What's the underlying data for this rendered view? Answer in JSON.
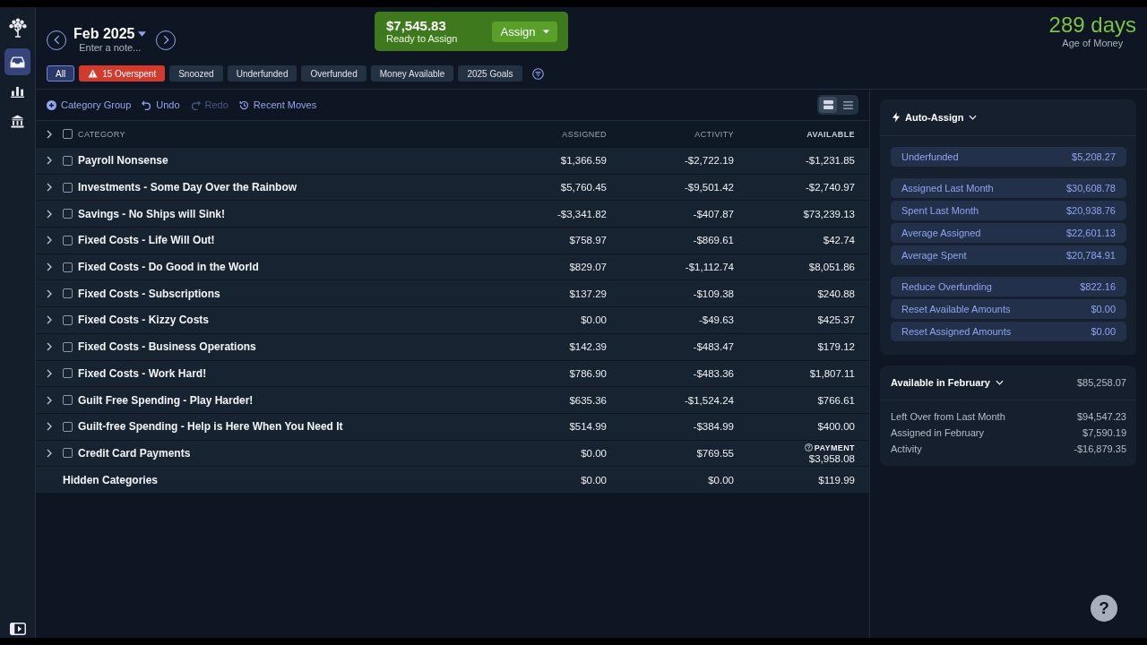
{
  "sidebar": {
    "items": [
      {
        "kind": "budget",
        "selected": true
      },
      {
        "kind": "reports",
        "selected": false
      },
      {
        "kind": "accounts",
        "selected": false
      }
    ]
  },
  "month": {
    "label": "Feb 2025",
    "note": {
      "placeholder": "Enter a note..."
    }
  },
  "ready_to_assign": {
    "amount": "$7,545.83",
    "label": "Ready to Assign",
    "button": "Assign"
  },
  "age_of_money": {
    "value": "289 days",
    "label": "Age of Money"
  },
  "filters": [
    {
      "label": "All",
      "kind": "plain",
      "selected": true
    },
    {
      "label": "15 Overspent",
      "kind": "alert",
      "selected": false
    },
    {
      "label": "Snoozed",
      "kind": "plain",
      "selected": false
    },
    {
      "label": "Underfunded",
      "kind": "plain",
      "selected": false
    },
    {
      "label": "Overfunded",
      "kind": "plain",
      "selected": false
    },
    {
      "label": "Money Available",
      "kind": "plain",
      "selected": false
    },
    {
      "label": "2025 Goals",
      "kind": "plain",
      "selected": false
    }
  ],
  "toolbar": [
    {
      "label": "Category Group",
      "kind": "add",
      "disabled": false
    },
    {
      "label": "Undo",
      "kind": "undo",
      "disabled": false
    },
    {
      "label": "Redo",
      "kind": "redo",
      "disabled": true
    },
    {
      "label": "Recent Moves",
      "kind": "history",
      "disabled": false
    }
  ],
  "view_toggle": [
    {
      "kind": "cards",
      "selected": true
    },
    {
      "kind": "list",
      "selected": false
    }
  ],
  "table": {
    "columns": [
      "CATEGORY",
      "ASSIGNED",
      "ACTIVITY",
      "AVAILABLE"
    ],
    "expand_all": {
      "expanded": false
    },
    "select_all": {
      "checked": false
    },
    "rows": [
      {
        "kind": "group",
        "name": "Payroll Nonsense",
        "assigned": "$1,366.59",
        "activity": "-$2,722.19",
        "available": "-$1,231.85",
        "expanded": false,
        "checked": false
      },
      {
        "kind": "group",
        "name": "Investments - Some Day Over the Rainbow",
        "assigned": "$5,760.45",
        "activity": "-$9,501.42",
        "available": "-$2,740.97",
        "expanded": false,
        "checked": false
      },
      {
        "kind": "group",
        "name": "Savings - No Ships will Sink!",
        "assigned": "-$3,341.82",
        "activity": "-$407.87",
        "available": "$73,239.13",
        "expanded": false,
        "checked": false
      },
      {
        "kind": "group",
        "name": "Fixed Costs - Life Will Out!",
        "assigned": "$758.97",
        "activity": "-$869.61",
        "available": "$42.74",
        "expanded": false,
        "checked": false
      },
      {
        "kind": "group",
        "name": "Fixed Costs - Do Good in the World",
        "assigned": "$829.07",
        "activity": "-$1,112.74",
        "available": "$8,051.86",
        "expanded": false,
        "checked": false
      },
      {
        "kind": "group",
        "name": "Fixed Costs - Subscriptions",
        "assigned": "$137.29",
        "activity": "-$109.38",
        "available": "$240.88",
        "expanded": false,
        "checked": false
      },
      {
        "kind": "group",
        "name": "Fixed Costs - Kizzy Costs",
        "assigned": "$0.00",
        "activity": "-$49.63",
        "available": "$425.37",
        "expanded": false,
        "checked": false
      },
      {
        "kind": "group",
        "name": "Fixed Costs - Business Operations",
        "assigned": "$142.39",
        "activity": "-$483.47",
        "available": "$179.12",
        "expanded": false,
        "checked": false
      },
      {
        "kind": "group",
        "name": "Fixed Costs - Work Hard!",
        "assigned": "$786.90",
        "activity": "-$483.36",
        "available": "$1,807.11",
        "expanded": false,
        "checked": false
      },
      {
        "kind": "group",
        "name": "Guilt Free Spending - Play Harder!",
        "assigned": "$635.36",
        "activity": "-$1,524.24",
        "available": "$766.61",
        "expanded": false,
        "checked": false
      },
      {
        "kind": "group",
        "name": "Guilt-free Spending - Help is Here When You Need It",
        "assigned": "$514.99",
        "activity": "-$384.99",
        "available": "$400.00",
        "expanded": false,
        "checked": false
      },
      {
        "kind": "group",
        "name": "Credit Card Payments",
        "assigned": "$0.00",
        "activity": "$769.55",
        "available": "$3,958.08",
        "available_label": "PAYMENT",
        "expanded": false,
        "checked": false
      },
      {
        "kind": "hidden",
        "name": "Hidden Categories",
        "assigned": "$0.00",
        "activity": "$0.00",
        "available": "$119.99"
      }
    ]
  },
  "auto_assign": {
    "title": "Auto-Assign",
    "expanded": true,
    "groups": [
      {
        "items": [
          {
            "label": "Underfunded",
            "value": "$5,208.27"
          }
        ]
      },
      {
        "items": [
          {
            "label": "Assigned Last Month",
            "value": "$30,608.78"
          },
          {
            "label": "Spent Last Month",
            "value": "$20,938.76"
          },
          {
            "label": "Average Assigned",
            "value": "$22,601.13"
          },
          {
            "label": "Average Spent",
            "value": "$20,784.91"
          }
        ]
      },
      {
        "items": [
          {
            "label": "Reduce Overfunding",
            "value": "$822.16"
          },
          {
            "label": "Reset Available Amounts",
            "value": "$0.00"
          },
          {
            "label": "Reset Assigned Amounts",
            "value": "$0.00"
          }
        ]
      }
    ]
  },
  "available": {
    "title": "Available in February",
    "total": "$85,258.07",
    "expanded": true,
    "rows": [
      {
        "label": "Left Over from Last Month",
        "value": "$94,547.23"
      },
      {
        "label": "Assigned in February",
        "value": "$7,590.19"
      },
      {
        "label": "Activity",
        "value": "-$16,879.35"
      }
    ]
  },
  "help_button": "?"
}
